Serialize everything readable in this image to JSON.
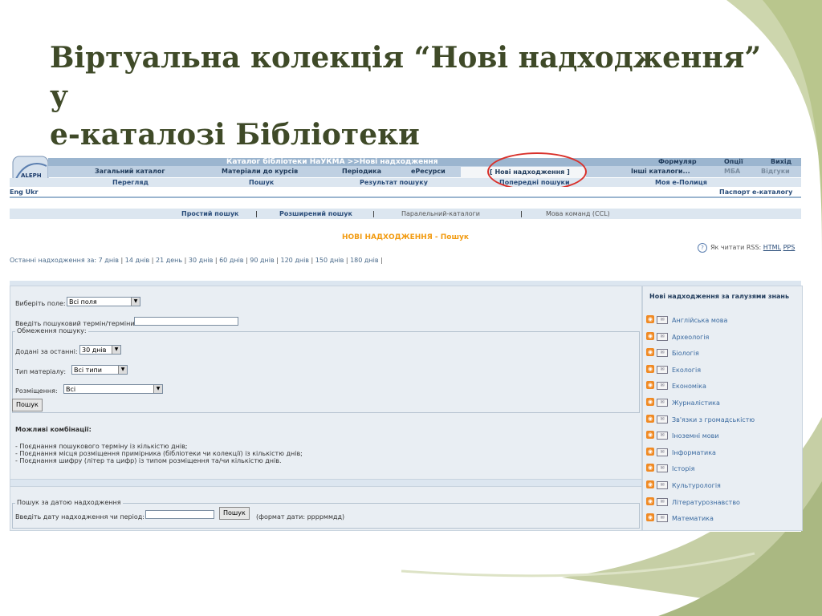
{
  "slide": {
    "title_line1": "Віртуальна колекція “Нові надходження” у",
    "title_line2": "е-каталозі Бібліотеки",
    "accent_color": "#3f4a28",
    "highlight_color": "#d9302a"
  },
  "screenshot": {
    "logo_text": "ALEPH",
    "catalog_title": "Каталог бібліотеки НаУКМА >>Нові надходження",
    "top_right": [
      "Формуляр",
      "Опції",
      "Вихід"
    ],
    "main_nav": [
      "Загальний каталог",
      "Матеріали до курсів",
      "Періодика",
      "еРесурси",
      "[ Нові надходження ]",
      "Інші каталоги...",
      "МБА",
      "Відгуки"
    ],
    "sub_nav": [
      "Перегляд",
      "Пошук",
      "Результат пошуку",
      "Попередні пошуки",
      "Моя е-Полиця"
    ],
    "lang": "Eng Ukr",
    "passport": "Паспорт е-каталогу",
    "search_modes": [
      "Простий пошук",
      "Розширений пошук",
      "Паралельний-каталоги",
      "Мова команд (CCL)"
    ],
    "search_sep": "|",
    "heading": "НОВІ НАДХОДЖЕННЯ - Пошук",
    "rss_help_icon": "help-icon",
    "rss_help_label": "Як читати RSS:",
    "rss_help_links": [
      "HTML",
      "PPS"
    ],
    "recent_label": "Останні надходження за:",
    "recent_periods": [
      "7 днів",
      "14 днів",
      "21 день",
      "30 днів",
      "60 днів",
      "90 днів",
      "120 днів",
      "150 днів",
      "180 днів"
    ],
    "form": {
      "field_label": "Виберіть поле:",
      "field_value": "Всі поля",
      "term_label": "Введіть пошуковий термін/терміни:",
      "term_value": "",
      "limits_legend": "Обмеження пошуку:",
      "added_label": "Додані за останні:",
      "added_value": "30 днів",
      "type_label": "Тип матеріалу:",
      "type_value": "Всі типи",
      "location_label": "Розміщення:",
      "location_value": "Всі",
      "search_button": "Пошук",
      "combos_title": "Можливі комбінації:",
      "combos": [
        "- Поєднання пошукового терміну із кількістю днів;",
        "- Поєднання місця розміщення примірника (бібліотеки чи колекції) із кількістю днів;",
        "- Поєднання шифру (літер та цифр) із типом розміщення та/чи кількістю днів."
      ],
      "date_legend": "Пошук за датою надходження",
      "date_label": "Введіть дату надходження чи період:",
      "date_value": "",
      "date_button": "Пошук",
      "date_format": "(формат дати: ррррммдд)"
    },
    "sidebar": {
      "title": "Нові надходження за галузями знань",
      "rss_icon": "rss-icon",
      "mail_icon": "mail-icon",
      "categories": [
        "Англійська мова",
        "Археологія",
        "Біологія",
        "Екологія",
        "Економіка",
        "Журналістика",
        "Зв'язки з громадськістю",
        "Іноземні мови",
        "Інформатика",
        "Історія",
        "Культурологія",
        "Літературознавство",
        "Математика"
      ]
    }
  }
}
